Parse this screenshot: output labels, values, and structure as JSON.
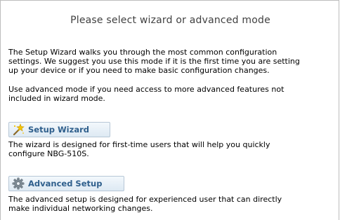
{
  "page": {
    "title": "Please select wizard or advanced mode"
  },
  "intro": {
    "line1": "The Setup Wizard walks you through the most common configuration",
    "line2": "settings. We suggest you use this mode if it is the first time you are setting",
    "line3": "up your device or if you need to make basic configuration changes."
  },
  "advanced_note": {
    "line1": "Use advanced mode if you need access to more advanced features not",
    "line2": "included in wizard mode."
  },
  "wizard": {
    "button_label": "Setup Wizard",
    "icon": "magic-wand-icon",
    "desc_line1": "The wizard is designed for first-time users that will help you quickly",
    "desc_line2": "configure NBG-510S."
  },
  "advanced": {
    "button_label": "Advanced Setup",
    "icon": "gear-icon",
    "desc_line1": "The advanced setup is designed for experienced user that can directly",
    "desc_line2": "make individual networking changes."
  },
  "colors": {
    "title_text": "#404040",
    "button_text": "#2f5f8c",
    "button_border": "#b7c7d6",
    "frame_border": "#bdbdbd"
  }
}
